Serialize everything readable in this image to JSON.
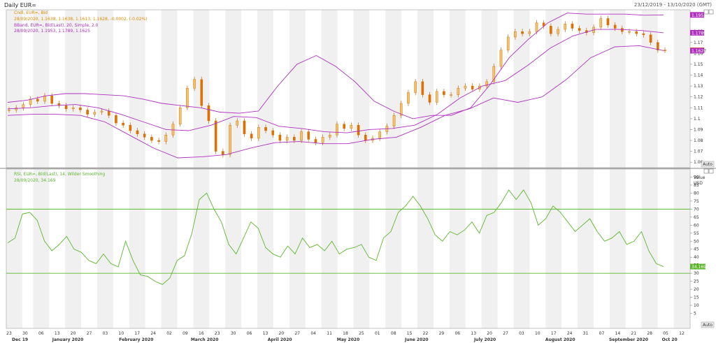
{
  "header": {
    "title": "Daily EUR=",
    "date_range": "23/12/2019 - 13/10/2020 (GMT)"
  },
  "price_panel": {
    "legend": [
      {
        "text": "Cndl, EUR=, Bid",
        "color": "#e08a00"
      },
      {
        "text": "28/09/2020, 1.1638, 1.1638, 1.1613, 1.1628, -0.0002, (-0.02%)",
        "color": "#e08a00",
        "suffix_color": "#c00000"
      },
      {
        "text": "BBand, EUR=, Bid(Last), 20, Simple, 2.0",
        "color": "#b030c0"
      },
      {
        "text": "28/09/2020, 1.1953, 1.1789, 1.1625",
        "color": "#b030c0"
      }
    ],
    "axis_ticks": [
      "1.18",
      "1.17",
      "1.16",
      "1.15",
      "1.14",
      "1.13",
      "1.12",
      "1.11",
      "1.1",
      "1.09",
      "1.08",
      "1.07",
      "1.06"
    ],
    "tags": [
      {
        "label": "1.1953",
        "value": 1.1953,
        "bg": "#b030c0",
        "fg": "#ffffff"
      },
      {
        "label": "1.1789",
        "value": 1.1789,
        "bg": "#b030c0",
        "fg": "#ffffff"
      },
      {
        "label": "1.1628",
        "value": 1.1628,
        "bg": "#ff8c00",
        "fg": "#000000"
      },
      {
        "label": "1.1625",
        "value": 1.1625,
        "bg": "#b030c0",
        "fg": "#ffffff"
      }
    ],
    "auto_label": "Auto"
  },
  "rsi_panel": {
    "legend": [
      {
        "text": "RSI, EUR=, Bid(Last), 14, Wilder Smoothing",
        "color": "#5cb82e"
      },
      {
        "text": "28/09/2020, 34.169",
        "color": "#5cb82e"
      }
    ],
    "axis_title": [
      "Value",
      "USD"
    ],
    "axis_ticks": [
      "90",
      "85",
      "80",
      "75",
      "70",
      "65",
      "60",
      "55",
      "50",
      "45",
      "40",
      "35",
      "30",
      "25",
      "20",
      "15",
      "10",
      "5"
    ],
    "current_label": "34.169",
    "auto_label": "Auto"
  },
  "x_axis": {
    "days": [
      "23",
      "30",
      "06",
      "13",
      "20",
      "27",
      "03",
      "10",
      "17",
      "24",
      "02",
      "09",
      "16",
      "23",
      "30",
      "06",
      "13",
      "20",
      "27",
      "04",
      "11",
      "18",
      "25",
      "01",
      "08",
      "15",
      "22",
      "29",
      "06",
      "13",
      "20",
      "27",
      "03",
      "10",
      "17",
      "24",
      "31",
      "07",
      "14",
      "21",
      "28",
      "05",
      "12"
    ],
    "months": [
      "Dec 19",
      "January 2020",
      "February 2020",
      "March 2020",
      "April 2020",
      "May 2020",
      "June 2020",
      "July 2020",
      "August 2020",
      "September 2020",
      "Oct 20"
    ]
  },
  "chart_data": [
    {
      "type": "candlestick",
      "title": "Daily EUR=",
      "x": [
        "2019-12-23",
        "2020-09-28"
      ],
      "series": [
        {
          "name": "Cndl, EUR=, Bid",
          "close_approx": [
            1.108,
            1.11,
            1.113,
            1.118,
            1.116,
            1.121,
            1.114,
            1.112,
            1.109,
            1.11,
            1.108,
            1.104,
            1.106,
            1.107,
            1.103,
            1.096,
            1.094,
            1.089,
            1.086,
            1.083,
            1.08,
            1.079,
            1.085,
            1.095,
            1.11,
            1.128,
            1.136,
            1.112,
            1.098,
            1.07,
            1.067,
            1.094,
            1.098,
            1.086,
            1.082,
            1.092,
            1.089,
            1.085,
            1.08,
            1.083,
            1.08,
            1.088,
            1.081,
            1.078,
            1.083,
            1.085,
            1.095,
            1.091,
            1.094,
            1.085,
            1.08,
            1.082,
            1.088,
            1.093,
            1.103,
            1.114,
            1.124,
            1.134,
            1.122,
            1.115,
            1.125,
            1.122,
            1.122,
            1.128,
            1.13,
            1.127,
            1.13,
            1.134,
            1.148,
            1.163,
            1.175,
            1.18,
            1.178,
            1.18,
            1.188,
            1.185,
            1.178,
            1.182,
            1.187,
            1.183,
            1.181,
            1.179,
            1.184,
            1.192,
            1.186,
            1.183,
            1.18,
            1.18,
            1.178,
            1.177,
            1.17,
            1.163,
            1.1628
          ]
        },
        {
          "name": "BBand upper",
          "values_approx": [
            1.115,
            1.117,
            1.121,
            1.123,
            1.123,
            1.122,
            1.121,
            1.118,
            1.114,
            1.112,
            1.11,
            1.106,
            1.105,
            1.107,
            1.13,
            1.15,
            1.158,
            1.148,
            1.134,
            1.116,
            1.107,
            1.1,
            1.103,
            1.103,
            1.11,
            1.131,
            1.156,
            1.173,
            1.188,
            1.197,
            1.196,
            1.196,
            1.196,
            1.195,
            1.1953
          ]
        },
        {
          "name": "BBand middle",
          "values_approx": [
            1.109,
            1.11,
            1.112,
            1.113,
            1.11,
            1.104,
            1.097,
            1.09,
            1.089,
            1.094,
            1.102,
            1.101,
            1.093,
            1.091,
            1.088,
            1.087,
            1.09,
            1.091,
            1.094,
            1.104,
            1.119,
            1.13,
            1.135,
            1.149,
            1.165,
            1.176,
            1.182,
            1.182,
            1.181,
            1.1789
          ]
        },
        {
          "name": "BBand lower",
          "values_approx": [
            1.103,
            1.104,
            1.104,
            1.103,
            1.097,
            1.085,
            1.073,
            1.064,
            1.065,
            1.067,
            1.073,
            1.078,
            1.079,
            1.077,
            1.077,
            1.081,
            1.083,
            1.092,
            1.103,
            1.109,
            1.119,
            1.115,
            1.12,
            1.136,
            1.156,
            1.166,
            1.167,
            1.1625
          ]
        }
      ],
      "ylim": [
        1.055,
        1.2
      ]
    },
    {
      "type": "line",
      "title": "RSI, EUR=, Bid(Last), 14, Wilder Smoothing",
      "ylabel": "Value USD",
      "ylim": [
        0,
        95
      ],
      "series": [
        {
          "name": "RSI, EUR=, Bid(Last), 14, Wilder Smoothing",
          "values": [
            49,
            52,
            67,
            68,
            63,
            50,
            44,
            48,
            53,
            45,
            43,
            38,
            36,
            42,
            36,
            34,
            50,
            38,
            29,
            28,
            25,
            23,
            27,
            38,
            41,
            55,
            76,
            80,
            70,
            62,
            48,
            42,
            52,
            62,
            58,
            46,
            42,
            40,
            47,
            42,
            52,
            46,
            48,
            44,
            50,
            42,
            45,
            46,
            48,
            40,
            38,
            52,
            56,
            68,
            72,
            78,
            72,
            64,
            54,
            50,
            56,
            54,
            57,
            62,
            55,
            66,
            68,
            74,
            82,
            76,
            82,
            74,
            60,
            64,
            72,
            68,
            62,
            56,
            60,
            64,
            56,
            50,
            52,
            56,
            48,
            50,
            56,
            44,
            36,
            34.169
          ]
        }
      ],
      "hlines": [
        70,
        30
      ]
    }
  ]
}
